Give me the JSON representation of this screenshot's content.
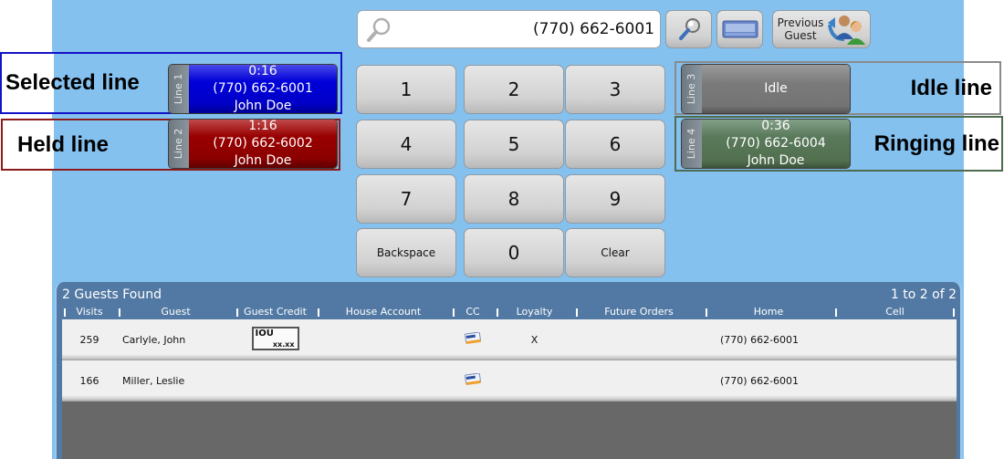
{
  "search": {
    "value": "(770) 662-6001",
    "icon": "magnifier-icon"
  },
  "toolbar": {
    "search_icon": "search-icon",
    "keyboard_icon": "keyboard-icon",
    "previous_guest_label_line1": "Previous",
    "previous_guest_label_line2": "Guest",
    "previous_guest_icon": "previous-guest-icon"
  },
  "keypad": {
    "keys": [
      "1",
      "2",
      "3",
      "4",
      "5",
      "6",
      "7",
      "8",
      "9",
      "Backspace",
      "0",
      "Clear"
    ]
  },
  "lines": [
    {
      "tab": "Line 1",
      "time": "0:16",
      "phone": "(770) 662-6001",
      "name": "John Doe",
      "state": "selected",
      "color": "#0000d0"
    },
    {
      "tab": "Line 2",
      "time": "1:16",
      "phone": "(770) 662-6002",
      "name": "John Doe",
      "state": "held",
      "color": "#8c0000"
    },
    {
      "tab": "Line 3",
      "status": "Idle",
      "state": "idle",
      "color": "#777777"
    },
    {
      "tab": "Line 4",
      "time": "0:36",
      "phone": "(770) 662-6004",
      "name": "John Doe",
      "state": "ringing",
      "color": "#587a58"
    }
  ],
  "annotations": {
    "selected": "Selected line",
    "held": "Held line",
    "idle": "Idle line",
    "ringing": "Ringing line"
  },
  "guests": {
    "title": "2 Guests Found",
    "range": "1 to 2 of 2",
    "columns": [
      "Visits",
      "Guest",
      "Guest Credit",
      "House Account",
      "CC",
      "Loyalty",
      "Future Orders",
      "Home",
      "Cell"
    ],
    "rows": [
      {
        "visits": "259",
        "guest": "Carlyle, John",
        "guest_credit": "IOU",
        "guest_credit_amount": "xx.xx",
        "house_account": "",
        "cc": "credit-card-icon",
        "loyalty": "X",
        "future_orders": "",
        "home": "(770) 662-6001",
        "cell": ""
      },
      {
        "visits": "166",
        "guest": "Miller, Leslie",
        "guest_credit": "",
        "house_account": "",
        "cc": "credit-card-icon",
        "loyalty": "",
        "future_orders": "",
        "home": "(770) 662-6001",
        "cell": ""
      }
    ]
  }
}
